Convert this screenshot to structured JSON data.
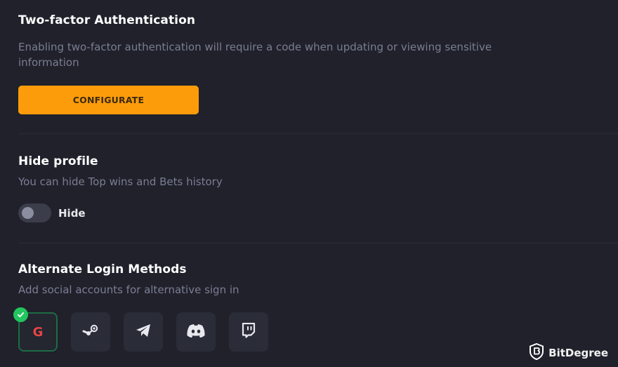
{
  "two_factor": {
    "title": "Two-factor Authentication",
    "description": "Enabling two-factor authentication will require a code when updating or viewing sensitive information",
    "button_label": "CONFIGURATE"
  },
  "hide_profile": {
    "title": "Hide profile",
    "description": "You can hide Top wins and Bets history",
    "toggle_label": "Hide",
    "toggle_on": false
  },
  "alternate_login": {
    "title": "Alternate Login Methods",
    "description": "Add social accounts for alternative sign in",
    "methods": [
      {
        "name": "google",
        "icon": "google-icon",
        "glyph": "G",
        "connected": true
      },
      {
        "name": "steam",
        "icon": "steam-icon",
        "connected": false
      },
      {
        "name": "telegram",
        "icon": "telegram-icon",
        "connected": false
      },
      {
        "name": "discord",
        "icon": "discord-icon",
        "connected": false
      },
      {
        "name": "twitch",
        "icon": "twitch-icon",
        "connected": false
      }
    ]
  },
  "watermark": {
    "text": "BitDegree",
    "icon": "bitdegree-shield-icon"
  },
  "colors": {
    "background": "#20212b",
    "accent": "#fd9c0b",
    "muted_text": "#7a7e93",
    "tile": "#2a2c37",
    "success": "#22c55e"
  }
}
